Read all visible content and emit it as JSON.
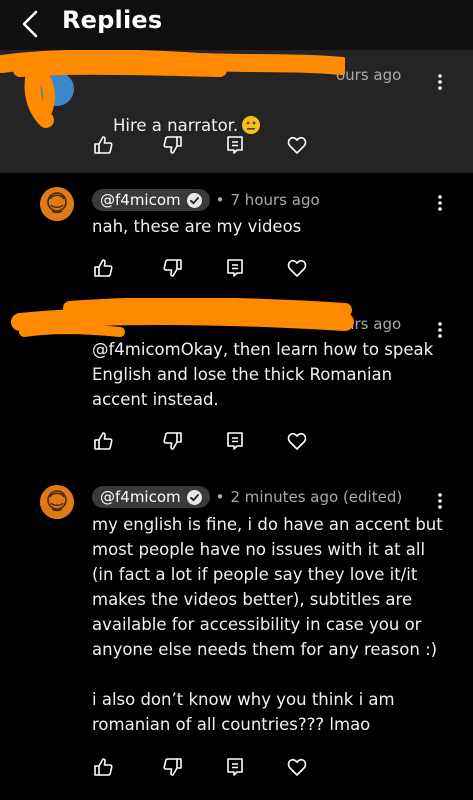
{
  "header": {
    "title": "Replies"
  },
  "comments": [
    {
      "author": "",
      "time": "ours ago",
      "text": "Hire a narrator.",
      "emoji": "neutral-face"
    },
    {
      "author": "@f4micom",
      "time": "7 hours ago",
      "text": "nah, these are my videos"
    },
    {
      "author": "",
      "time": "urs ago",
      "text": "@f4micomOkay, then learn how to speak\nEnglish and lose the thick Romanian\naccent instead."
    },
    {
      "author": "@f4micom",
      "time": "2 minutes ago (edited)",
      "text": "my english is fine, i do have an accent but\nmost people have no issues with it at all\n(in fact a lot if people say they love it/it\nmakes the videos better), subtitles are\navailable for accessibility in case you or\nanyone else needs them for any reason :)\n\ni also don’t know why you think i am\nromanian of all countries??? lmao"
    }
  ],
  "colors": {
    "redaction": "#ff8a00",
    "highlight_bg": "#242424",
    "avatar": "#e07a18"
  }
}
